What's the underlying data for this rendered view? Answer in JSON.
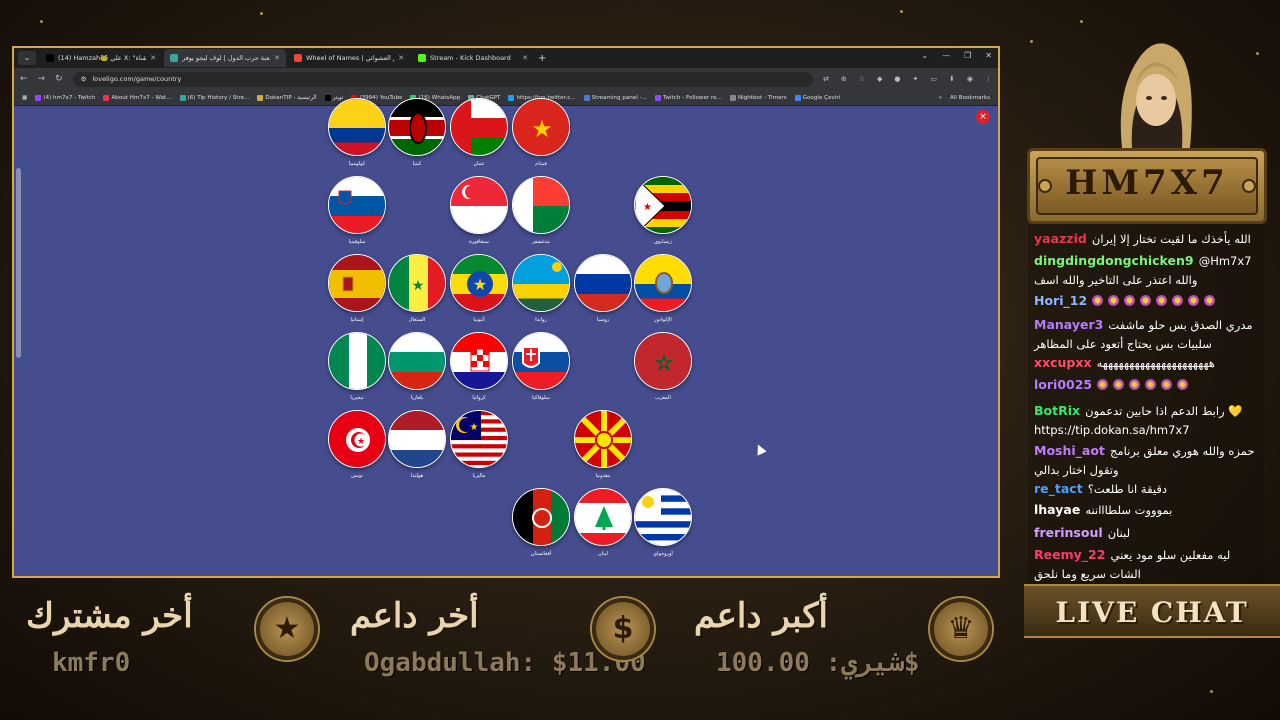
{
  "browser": {
    "tabs": [
      {
        "title": "(14) Hamzah🐸 علي X: \"القناة",
        "icon_color": "#000000",
        "active": false
      },
      {
        "title": "لعبة حرب الدول | لوف ليجو يوفر",
        "icon_color": "#3aa6a0",
        "active": true
      },
      {
        "title": "Wheel of Names | مم العشوائي",
        "icon_color": "#e84a3a",
        "active": false
      },
      {
        "title": "Stream - Kick Dashboard",
        "icon_color": "#53fc18",
        "active": false
      }
    ],
    "url": "loveligo.com/game/country",
    "bookmarks": [
      "(4) hm7x7 - Twitch",
      "About Hm7x7 - Wat...",
      "(6) Tip History / Stre...",
      "DokanTIP - الرئيسية",
      "تويتر",
      "(3994) YouTube",
      "(16) WhatsApp",
      "ChatGPT",
      "https://ton.twitter.c...",
      "Streaming panel -...",
      "Twitch - Follower re...",
      "Nightbot - Timers",
      "Google Çeviri"
    ],
    "all_bookmarks": "All Bookmarks",
    "close_button": "×"
  },
  "game": {
    "flags": [
      {
        "id": "colombia",
        "label": "كولومبيا",
        "icon": "colombia-flag"
      },
      {
        "id": "kenya",
        "label": "كينيا",
        "icon": "kenya-flag"
      },
      {
        "id": "oman",
        "label": "عمان",
        "icon": "oman-flag"
      },
      {
        "id": "vietnam",
        "label": "فيتنام",
        "icon": "vietnam-flag"
      },
      {
        "id": "slovenia",
        "label": "سلوفينيا",
        "icon": "slovenia-flag"
      },
      {
        "id": "singapore",
        "label": "سنغافورة",
        "icon": "singapore-flag"
      },
      {
        "id": "madagascar",
        "label": "مدغشقر",
        "icon": "madagascar-flag"
      },
      {
        "id": "zimbabwe",
        "label": "زيمبابوي",
        "icon": "zimbabwe-flag"
      },
      {
        "id": "spain",
        "label": "إسبانيا",
        "icon": "spain-flag"
      },
      {
        "id": "senegal",
        "label": "السنغال",
        "icon": "senegal-flag"
      },
      {
        "id": "ethiopia",
        "label": "أثيوبيا",
        "icon": "ethiopia-flag"
      },
      {
        "id": "rwanda",
        "label": "رواندا",
        "icon": "rwanda-flag"
      },
      {
        "id": "russia",
        "label": "روسيا",
        "icon": "russia-flag"
      },
      {
        "id": "ecuador",
        "label": "الإكوادور",
        "icon": "ecuador-flag"
      },
      {
        "id": "nigeria",
        "label": "نيجيريا",
        "icon": "nigeria-flag"
      },
      {
        "id": "bulgaria",
        "label": "بلغاريا",
        "icon": "bulgaria-flag"
      },
      {
        "id": "croatia",
        "label": "كرواتيا",
        "icon": "croatia-flag"
      },
      {
        "id": "slovakia",
        "label": "سلوفاكيا",
        "icon": "slovakia-flag"
      },
      {
        "id": "morocco",
        "label": "المغرب",
        "icon": "morocco-flag"
      },
      {
        "id": "tunisia",
        "label": "تونس",
        "icon": "tunisia-flag"
      },
      {
        "id": "netherlands",
        "label": "هولندا",
        "icon": "netherlands-flag"
      },
      {
        "id": "malaysia",
        "label": "ماليزيا",
        "icon": "malaysia-flag"
      },
      {
        "id": "macedonia",
        "label": "مقدونيا",
        "icon": "macedonia-flag"
      },
      {
        "id": "afghanistan",
        "label": "أفغانستان",
        "icon": "afghanistan-flag"
      },
      {
        "id": "lebanon",
        "label": "لبنان",
        "icon": "lebanon-flag"
      },
      {
        "id": "uruguay",
        "label": "أوروجواي",
        "icon": "uruguay-flag"
      }
    ]
  },
  "overlay": {
    "channel_name": "HM7X7",
    "live_chat_label": "LIVE CHAT",
    "latest_subscriber_title": "أخر مشترك",
    "latest_subscriber": "kmfr0",
    "latest_supporter_title": "أخر داعم",
    "latest_supporter": "Ogabdullah: $11.00",
    "top_supporter_title": "أكبر داعم",
    "top_supporter": "شيري: 100.00$",
    "icons": {
      "star": "★",
      "dollar": "$",
      "crown": "♛"
    }
  },
  "chat": [
    {
      "user": "yaazzid",
      "color": "#e8364e",
      "text": "الله يأخذك ما لقيت تختار إلا إيران",
      "emotes": 0
    },
    {
      "user": "dingdingdongchicken9",
      "color": "#7cf27a",
      "text": "@Hm7x7 والله اعتذر على التاخير والله اسف",
      "emotes": 0
    },
    {
      "user": "Hori_12",
      "color": "#8fb4ff",
      "text": "",
      "emotes": 8
    },
    {
      "user": "Manayer3",
      "color": "#b47cff",
      "text": "مدري الصدق بس حلو ماشفت سلبيات بس يحتاج أتعود على المظاهر",
      "emotes": 0
    },
    {
      "user": "xxcupxx",
      "color": "#ff4a6a",
      "text": "هههههههههههههههههههههه",
      "emotes": 0
    },
    {
      "user": "lori0025",
      "color": "#b47cff",
      "text": "",
      "emotes": 6
    },
    {
      "user": "BotRix",
      "color": "#38e86a",
      "text": "رابط الدعم اذا حابين تدعمون 💛 https://tip.dokan.sa/hm7x7",
      "emotes": 0
    },
    {
      "user": "Moshi_aot",
      "color": "#c07cff",
      "text": "حمزه والله هوري معلق برنامج وتقول اختار بدالي",
      "emotes": 0
    },
    {
      "user": "re_tact",
      "color": "#4aa0ff",
      "text": "دقيقة انا طلعت؟",
      "emotes": 0
    },
    {
      "user": "lhayae",
      "color": "#ffffff",
      "text": "بموووت سلطاااننه",
      "emotes": 0
    },
    {
      "user": "frerinsoul",
      "color": "#d0a0ff",
      "text": "لبنان",
      "emotes": 0
    },
    {
      "user": "Reemy_22",
      "color": "#ff3a6a",
      "text": "ليه مفعلين سلو مود يعني الشات سريع وما نلحق",
      "emotes": 0
    }
  ]
}
